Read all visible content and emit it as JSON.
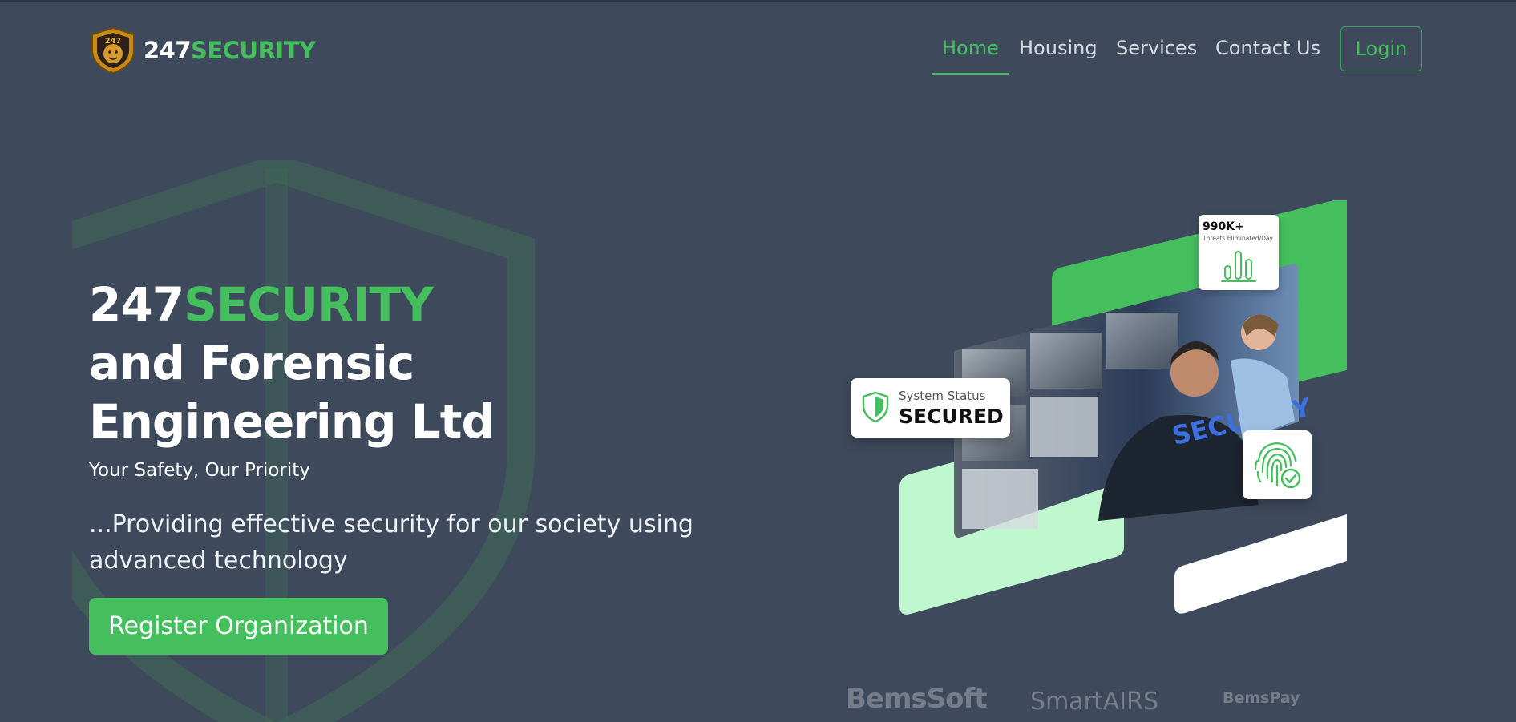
{
  "brand": {
    "name_part1": "247",
    "name_part2": "SECURITY",
    "logo_icon": "247-security-lion-badge-icon"
  },
  "nav": {
    "items": [
      {
        "label": "Home",
        "active": true
      },
      {
        "label": "Housing",
        "active": false
      },
      {
        "label": "Services",
        "active": false
      },
      {
        "label": "Contact Us",
        "active": false
      }
    ],
    "login_label": "Login"
  },
  "hero": {
    "title_part1": "247",
    "title_part2": "SECURITY",
    "title_line2": "and Forensic",
    "title_line3": "Engineering Ltd",
    "tagline": "Your Safety, Our Priority",
    "description": "...Providing effective security for our society using advanced technology",
    "cta_label": "Register Organization"
  },
  "stats_card": {
    "value": "990K+",
    "caption": "Threats Eliminated/Day",
    "icon": "bar-chart-icon"
  },
  "status_card": {
    "label": "System Status",
    "value": "SECURED",
    "icon": "shield-icon"
  },
  "fingerprint_card": {
    "icon": "fingerprint-check-icon"
  },
  "partners": [
    {
      "name": "BemsSoft"
    },
    {
      "name": "SmartAIRS"
    },
    {
      "name": "BemsPay"
    }
  ],
  "colors": {
    "background": "#3e4a5c",
    "accent": "#45bf5e",
    "light_green": "#bff7cf"
  }
}
